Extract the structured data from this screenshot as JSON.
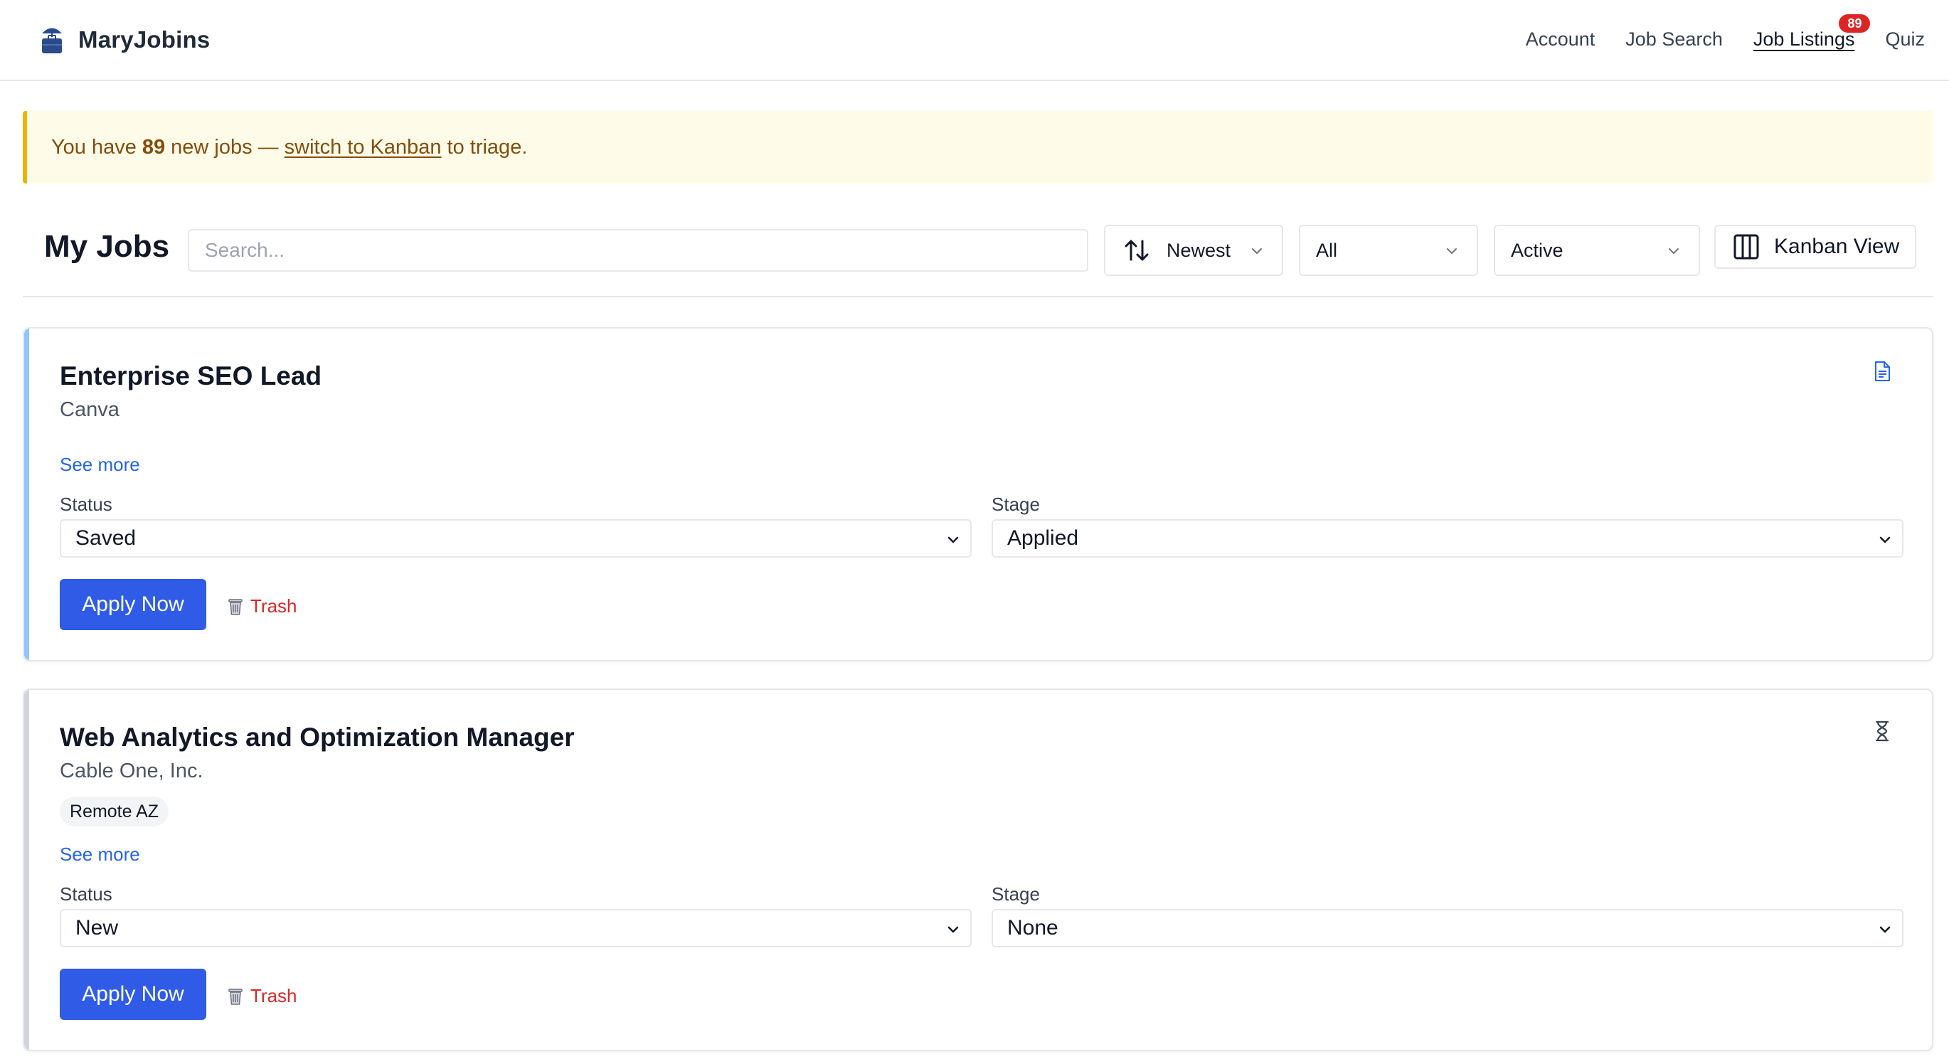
{
  "app": {
    "name": "MaryJobins"
  },
  "nav": {
    "items": [
      {
        "label": "Account"
      },
      {
        "label": "Job Search"
      },
      {
        "label": "Job Listings",
        "active": true,
        "badge": "89"
      },
      {
        "label": "Quiz"
      }
    ]
  },
  "banner": {
    "prefix": "You have",
    "count": "89",
    "middle": "new jobs —",
    "link": "switch to Kanban",
    "suffix": "to triage."
  },
  "toolbar": {
    "title": "My Jobs",
    "search_placeholder": "Search...",
    "sort_value": "Newest",
    "filter_value": "All",
    "state_value": "Active",
    "kanban_label": "Kanban View"
  },
  "jobs": [
    {
      "title": "Enterprise SEO Lead",
      "company": "Canva",
      "tags": [],
      "see_more": "See more",
      "status_label": "Status",
      "status_value": "Saved",
      "stage_label": "Stage",
      "stage_value": "Applied",
      "apply_label": "Apply Now",
      "trash_label": "Trash",
      "accent_color": "#93c5fd",
      "corner_icon": "document-icon"
    },
    {
      "title": "Web Analytics and Optimization Manager",
      "company": "Cable One, Inc.",
      "tags": [
        "Remote AZ"
      ],
      "see_more": "See more",
      "status_label": "Status",
      "status_value": "New",
      "stage_label": "Stage",
      "stage_value": "None",
      "apply_label": "Apply Now",
      "trash_label": "Trash",
      "accent_color": "#d1d5db",
      "corner_icon": "hourglass-icon"
    }
  ],
  "colors": {
    "primary": "#2f5be7",
    "link": "#2563eb",
    "danger": "#dc2626",
    "banner_bg": "#fefce8",
    "banner_border": "#eab308",
    "banner_text": "#854d0e"
  }
}
